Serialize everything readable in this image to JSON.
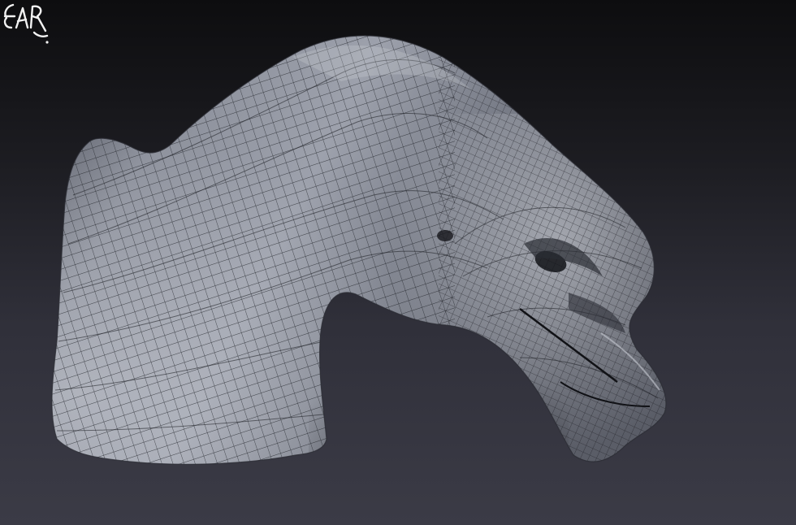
{
  "scene": {
    "subject_icon": "sculpted-creature-head-icon",
    "mesh": "quad-wireframe",
    "colors": {
      "background_top": "#0d0d0f",
      "background_bottom": "#3b3b46",
      "surface": "#8a8e9a",
      "wire": "#1b1d22"
    }
  },
  "signature": {
    "text": "EAR."
  }
}
